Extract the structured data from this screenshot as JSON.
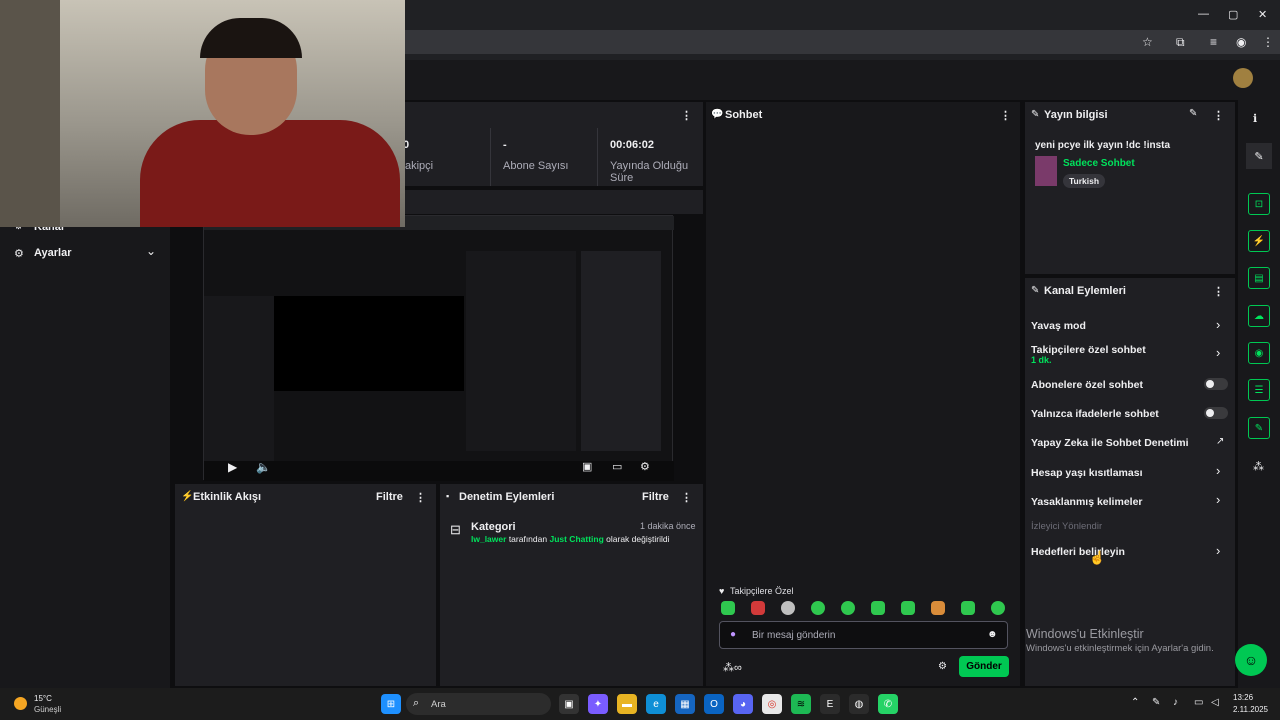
{
  "browser": {
    "window_controls": [
      "—",
      "▢",
      "✕"
    ]
  },
  "stats": {
    "follower_value": "0",
    "follower_label": "akipçi",
    "sub_value": "-",
    "sub_label": "Abone Sayısı",
    "uptime_value": "00:06:02",
    "uptime_label": "Yayında Olduğu Süre"
  },
  "sidebar": {
    "item_kanal": "Kanal",
    "item_ayarlar": "Ayarlar"
  },
  "chat": {
    "title": "Sohbet",
    "followers_only": "Takipçilere Özel",
    "placeholder": "Bir mesaj gönderin",
    "send": "Gönder"
  },
  "stream_info": {
    "title": "Yayın bilgisi",
    "stream_title": "yeni pcye ilk yayın !dc !insta",
    "category": "Sadece Sohbet",
    "tag": "Turkish"
  },
  "channel_actions": {
    "title": "Kanal Eylemleri",
    "items": [
      "Yavaş mod",
      "Takipçilere özel sohbet",
      "Abonelere özel sohbet",
      "Yalnızca ifadelerle sohbet",
      "Yapay Zeka ile Sohbet Denetimi",
      "Hesap yaşı kısıtlaması",
      "Yasaklanmış kelimeler"
    ],
    "follower_sub": "1 dk.",
    "section": "İzleyici Yönlendir",
    "goal": "Hedefleri belirleyin"
  },
  "activity": {
    "title": "Etkinlik Akışı",
    "filter": "Filtre"
  },
  "moderation": {
    "title": "Denetim Eylemleri",
    "filter": "Filtre",
    "entry_title": "Kategori",
    "entry_time": "1 dakika önce",
    "entry_user": "lw_lawer",
    "entry_mid": "tarafından",
    "entry_cat": "Just Chatting",
    "entry_end": "olarak değiştirildi"
  },
  "watermark": {
    "line1": "Windows'u Etkinleştir",
    "line2": "Windows'u etkinleştirmek için Ayarlar'a gidin."
  },
  "taskbar": {
    "temp": "15°C",
    "weather": "Güneşli",
    "search": "Ara",
    "time": "13:26",
    "date": "2.11.2025"
  },
  "colors": {
    "accent": "#00e25c",
    "panel": "#1f1f23",
    "bg": "#0e0e10"
  }
}
